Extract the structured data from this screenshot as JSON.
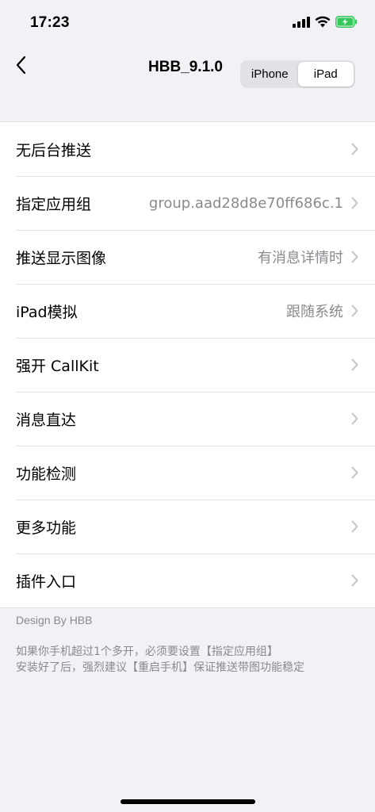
{
  "status_bar": {
    "time": "17:23"
  },
  "nav": {
    "title": "HBB_9.1.0",
    "segments": [
      "iPhone",
      "iPad"
    ],
    "selected_segment": "iPad"
  },
  "settings": [
    {
      "label": "无后台推送",
      "value": ""
    },
    {
      "label": "指定应用组",
      "value": "group.aad28d8e70ff686c.1"
    },
    {
      "label": "推送显示图像",
      "value": "有消息详情时"
    },
    {
      "label": "iPad模拟",
      "value": "跟随系统"
    },
    {
      "label": "强开 CallKit",
      "value": ""
    },
    {
      "label": "消息直达",
      "value": ""
    },
    {
      "label": "功能检测",
      "value": ""
    },
    {
      "label": "更多功能",
      "value": ""
    },
    {
      "label": "插件入口",
      "value": ""
    }
  ],
  "footer": {
    "credit": "Design By HBB",
    "note_line1": "如果你手机超过1个多开，必须要设置【指定应用组】",
    "note_line2": "安装好了后，强烈建议【重启手机】保证推送带图功能稳定"
  },
  "colors": {
    "background": "#f2f1f6",
    "secondary_text": "#8a8a8e",
    "battery_green": "#34c759"
  },
  "icons": {
    "signal": "cellular-signal-icon",
    "wifi": "wifi-icon",
    "battery": "battery-charging-icon",
    "back": "chevron-left-icon",
    "row_arrow": "chevron-right-icon"
  }
}
